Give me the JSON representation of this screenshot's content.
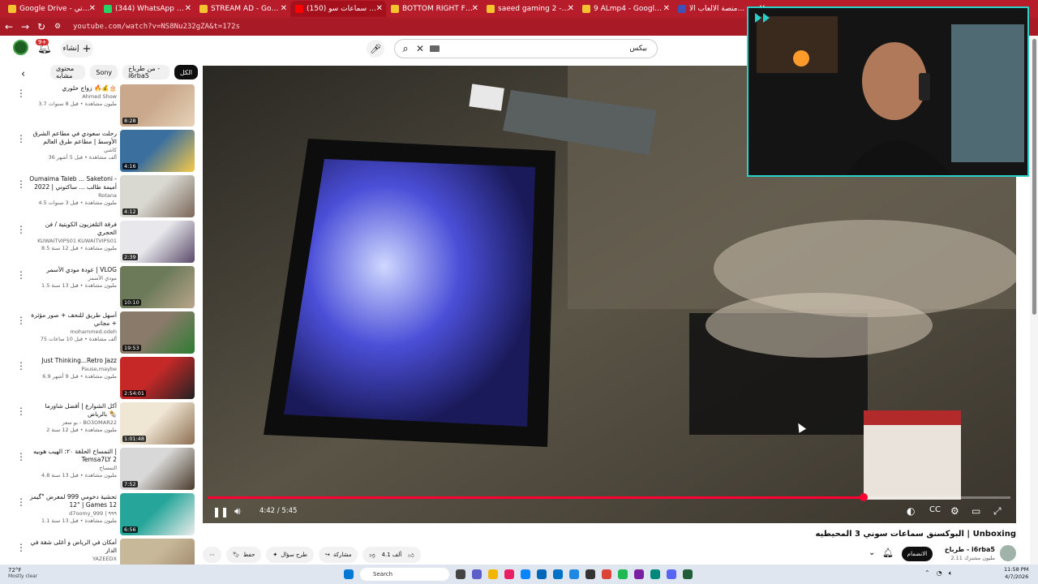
{
  "browser": {
    "tabs": [
      {
        "title": "Google Drive - ملفاتي",
        "color": "#f4c430"
      },
      {
        "title": "(344) WhatsApp Business",
        "color": "#25d366"
      },
      {
        "title": "STREAM AD - Google Drive",
        "color": "#f4c430"
      },
      {
        "title": "(150) البوكسنق سماعات سو",
        "color": "#ff0000"
      },
      {
        "title": "BOTTOM RIGHT FULL.mov - Go",
        "color": "#f4c430"
      },
      {
        "title": "saeed gaming 2 - Google Drive",
        "color": "#f4c430"
      },
      {
        "title": "9 ALmp4 - Google Drive",
        "color": "#f4c430"
      },
      {
        "title": "منصة الألعاب الأ...",
        "color": "#3f51b5"
      }
    ],
    "url": "youtube.com/watch?v=NS8Nu232gZA&t=172s"
  },
  "header": {
    "create_label": "إنشاء",
    "notif_count": "9+",
    "search_value": "بيكس"
  },
  "sidebar": {
    "chips": [
      "الكل",
      "من طرباخ - i6rba5",
      "Sony",
      "محتوى مشابه"
    ],
    "recs": [
      {
        "title": "زواج حلوري 🔥💰🎂",
        "channel": "Ahmed Show",
        "meta": "3.7 مليون مشاهدة • قبل 8 سنوات",
        "duration": "8:28",
        "c1": "#c9a88b",
        "c2": "#e6d2b8"
      },
      {
        "title": "رحلت سعودي في مطاعم الشرق الأوسط | مطاعم طرق العالم",
        "channel": "كاشي",
        "meta": "36 ألف مشاهدة • قبل 5 أشهر",
        "duration": "4:16",
        "c1": "#3b6f9e",
        "c2": "#f7c948"
      },
      {
        "title": "Oumaima Taleb ... Saketoni - أميمة طالب ... ساكتوني | 2022",
        "channel": "Rotana",
        "meta": "4.5 مليون مشاهدة • قبل 3 سنوات",
        "duration": "4:12",
        "c1": "#d9d9d2",
        "c2": "#7a6658"
      },
      {
        "title": "فرقة التلفزيون الكويتية / فن الحجري",
        "channel": "KUWAITVIPS01 KUWAITVIPS01",
        "meta": "8.5 مليون مشاهدة • قبل 12 سنة",
        "duration": "2:39",
        "c1": "#e8e8ec",
        "c2": "#5a4a6a"
      },
      {
        "title": "عودة مودي الأسمر | VLOG",
        "channel": "مودي الأسمر",
        "meta": "1.5 مليون مشاهدة • قبل 13 سنة",
        "duration": "10:10",
        "c1": "#6c7a5a",
        "c2": "#b8a58a"
      },
      {
        "title": "أسهل طريق للنحف + صور مؤثرة + مجاني",
        "channel": "mohammed.odeh",
        "meta": "75 ألف مشاهدة • قبل 10 ساعات",
        "duration": "19:53",
        "c1": "#8a7a6a",
        "c2": "#2e7d32"
      },
      {
        "title": "Just Thinking...Retro Jazz",
        "channel": "Pause,maybe",
        "meta": "6.9 مليون مشاهدة • قبل 9 أشهر",
        "duration": "2:54:01",
        "c1": "#c62828",
        "c2": "#222222"
      },
      {
        "title": "أكل الشوارع | أفضل شاورما بالرياض 🌯",
        "channel": "بو سعر - BO3OMAR22",
        "meta": "2 مليون مشاهدة • قبل 12 سنة",
        "duration": "1:01:48",
        "c1": "#efe6d3",
        "c2": "#8d6e52"
      },
      {
        "title": "التمساح الحلقة ٢٠: الهيب هوبيه | Temsa7LY 2",
        "channel": "التمساح",
        "meta": "4.8 مليون مشاهدة • قبل 13 سنة",
        "duration": "7:52",
        "c1": "#d8d8d8",
        "c2": "#4a3a2a"
      },
      {
        "title": "تحشية دخومي 999 لمعرض \"گيمز 12\" | Games 12",
        "channel": "d7oomy_999 | ٩٩٩",
        "meta": "1.1 مليون مشاهدة • قبل 13 سنة",
        "duration": "6:56",
        "c1": "#26a69a",
        "c2": "#ececec"
      },
      {
        "title": "أمكان في الرياض و أغلى شقة في الدار",
        "channel": "YAZEEDX",
        "meta": "",
        "duration": "",
        "c1": "#c8b89a",
        "c2": "#9a8266"
      }
    ]
  },
  "player": {
    "current_time": "4:42",
    "duration": "5:45",
    "time_label": "4:42 / 5:45",
    "progress": 0.817
  },
  "video": {
    "title": "البوكسنق سماعات سوني 3 المحيطيه | Unboxing",
    "channel": "طرباخ - i6rba5",
    "subscribers": "2.11 مليون مشترك",
    "join_label": "الانضمام",
    "likes": "4.1 ألف",
    "share_label": "مشاركة",
    "ask_label": "طرح سؤال",
    "save_label": "حفظ"
  },
  "taskbar": {
    "temp": "72°F",
    "weather": "Mostly clear",
    "search": "Search",
    "time": "11:58 PM",
    "date": "4/7/2026"
  },
  "colors": {
    "tabbar": "#b71c2b",
    "progress": "#ff0033",
    "webcam_border": "#2ad1c9"
  }
}
